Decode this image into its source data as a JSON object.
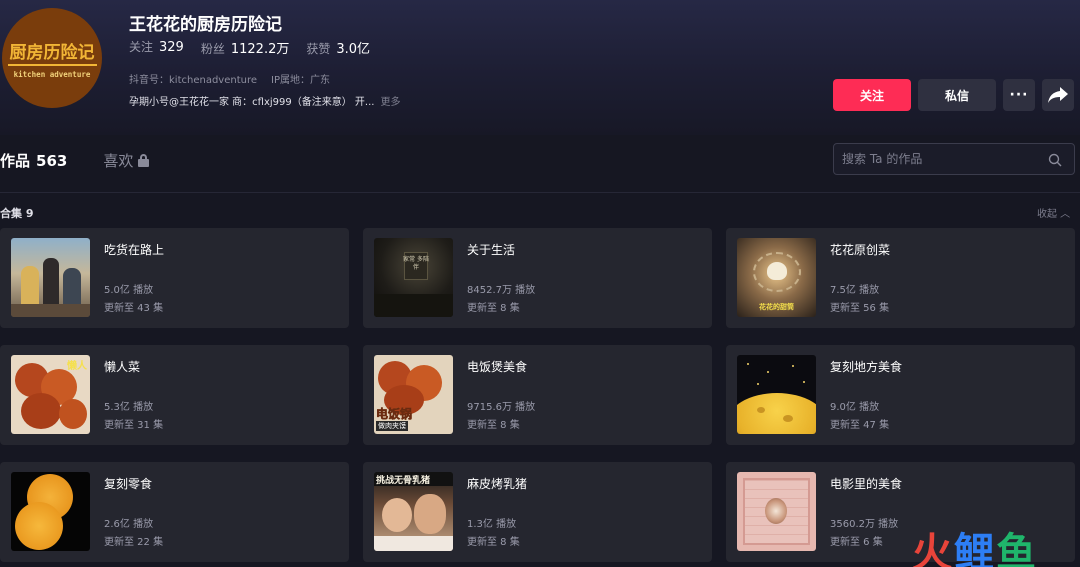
{
  "profile": {
    "avatar_text_cn": "厨房历险记",
    "avatar_text_en": "kitchen adventure",
    "name": "王花花的厨房历险记",
    "stats": [
      {
        "label": "关注",
        "value": "329"
      },
      {
        "label": "粉丝",
        "value": "1122.2万"
      },
      {
        "label": "获赞",
        "value": "3.0亿"
      }
    ],
    "douyin_id": "抖音号：kitchenadventure",
    "ip_location": "IP属地：广东",
    "bio": "孕期小号@王花花一家 商：cflxj999（备注来意） 开...",
    "bio_more": "更多"
  },
  "actions": {
    "follow": "关注",
    "message": "私信",
    "more": "···"
  },
  "tabs": {
    "works_label": "作品",
    "works_count": "563",
    "likes_label": "喜欢"
  },
  "search": {
    "placeholder": "搜索 Ta 的作品"
  },
  "collections": {
    "header": "合集 9",
    "collapse": "收起",
    "items": [
      {
        "title": "吃货在路上",
        "plays": "5.0亿 播放",
        "episodes": "更新至 43 集"
      },
      {
        "title": "关于生活",
        "plays": "8452.7万 播放",
        "episodes": "更新至 8 集"
      },
      {
        "title": "花花原创菜",
        "plays": "7.5亿 播放",
        "episodes": "更新至 56 集"
      },
      {
        "title": "懒人菜",
        "plays": "5.3亿 播放",
        "episodes": "更新至 31 集"
      },
      {
        "title": "电饭煲美食",
        "plays": "9715.6万 播放",
        "episodes": "更新至 8 集"
      },
      {
        "title": "复刻地方美食",
        "plays": "9.0亿 播放",
        "episodes": "更新至 47 集"
      },
      {
        "title": "复刻零食",
        "plays": "2.6亿 播放",
        "episodes": "更新至 22 集"
      },
      {
        "title": "麻皮烤乳猪",
        "plays": "1.3亿 播放",
        "episodes": "更新至 8 集"
      },
      {
        "title": "电影里的美食",
        "plays": "3560.2万 播放",
        "episodes": "更新至 6 集"
      }
    ],
    "thumb_texts": {
      "t2": "家常 多陪伴",
      "t3": "花花的甜筒",
      "t4": "懒人",
      "t5a": "电饭锅",
      "t5b": "做肉夹馍",
      "t8": "挑战无骨乳猪"
    }
  },
  "watermark": {
    "c1": "火",
    "c2": "鲤",
    "c3": "鱼"
  },
  "colors": {
    "accent": "#fe2c55",
    "background": "#161722",
    "card": "#25262f"
  }
}
